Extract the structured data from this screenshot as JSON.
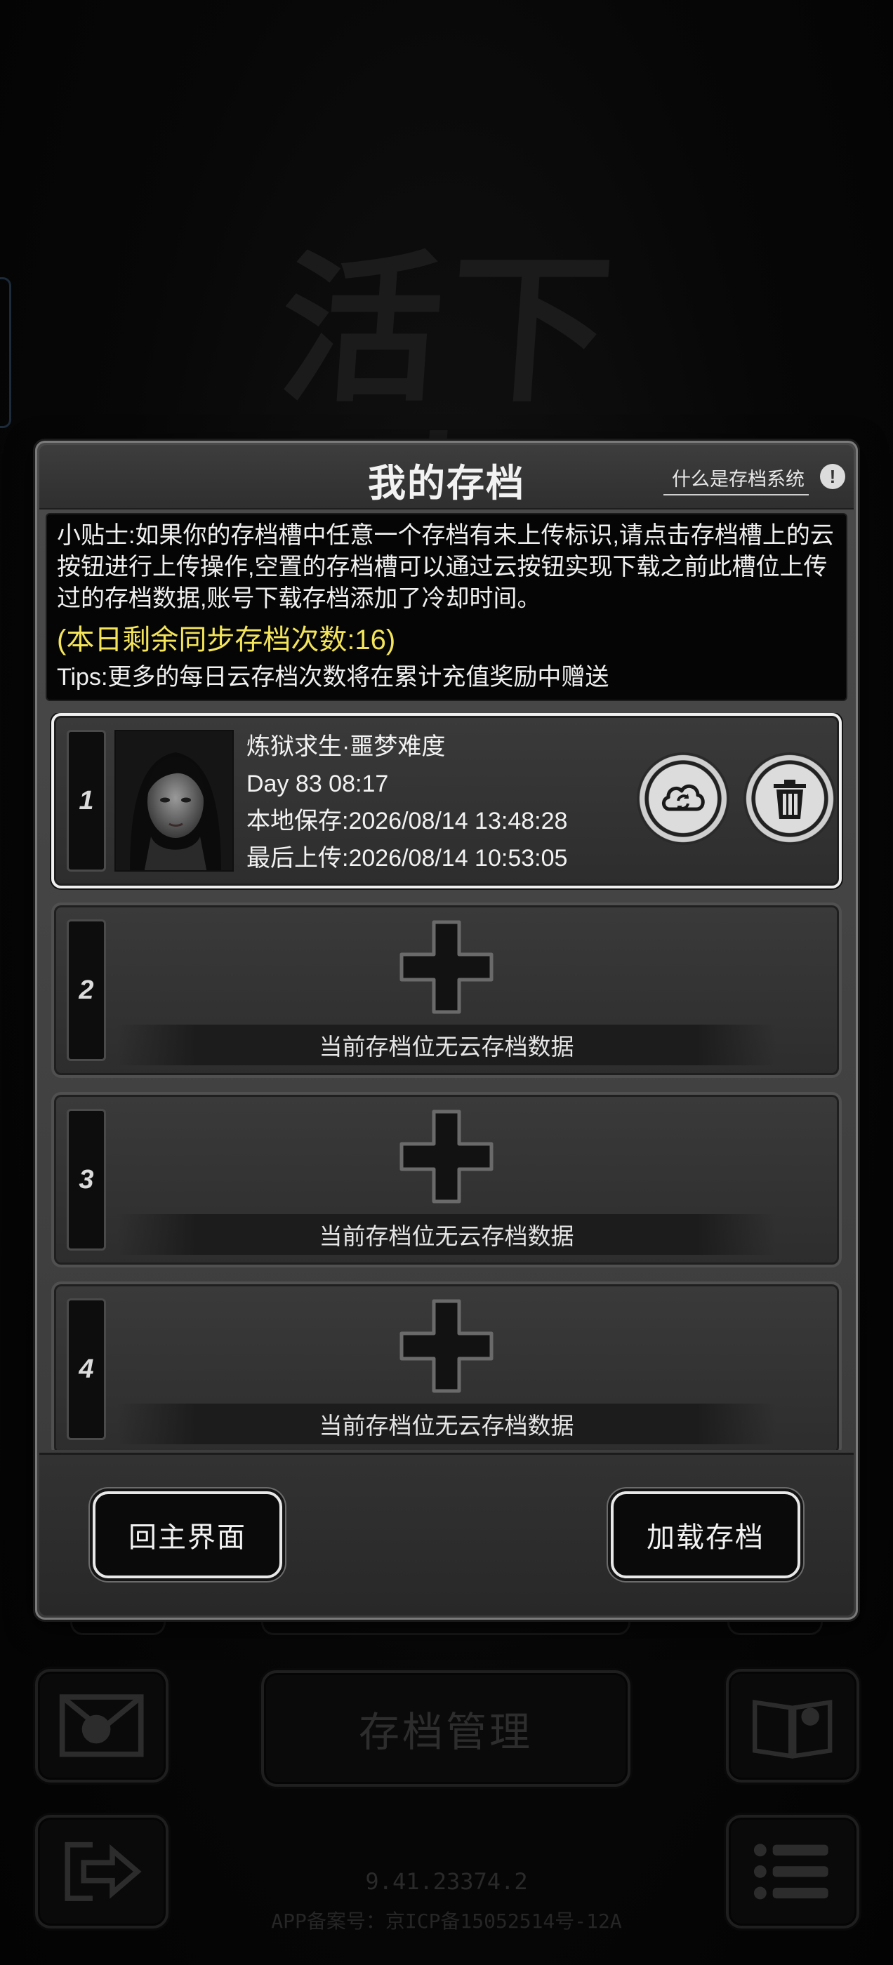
{
  "background": {
    "logo_text": "活下去",
    "manage_button": "存档管理",
    "version": "9.41.23374.2",
    "icp": "APP备案号：京ICP备15052514号-12A"
  },
  "modal": {
    "title": "我的存档",
    "help_link": "什么是存档系统",
    "help_icon": "!",
    "tips": {
      "main": "小贴士:如果你的存档槽中任意一个存档有未上传标识,请点击存档槽上的云按钮进行上传操作,空置的存档槽可以通过云按钮实现下载之前此槽位上传过的存档数据,账号下载存档添加了冷却时间。",
      "sync_count": "(本日剩余同步存档次数:16)",
      "extra": "Tips:更多的每日云存档次数将在累计充值奖励中赠送"
    },
    "slots": [
      {
        "number": "1",
        "title": "炼狱求生·噩梦难度",
        "day": "Day 83  08:17",
        "local_save": "本地保存:2026/08/14  13:48:28",
        "last_upload": "最后上传:2026/08/14  10:53:05",
        "upload_icon": "cloud-sync-icon",
        "delete_icon": "trash-icon"
      },
      {
        "number": "2",
        "empty_text": "当前存档位无云存档数据",
        "add_icon": "plus-icon"
      },
      {
        "number": "3",
        "empty_text": "当前存档位无云存档数据",
        "add_icon": "plus-icon"
      },
      {
        "number": "4",
        "empty_text": "当前存档位无云存档数据",
        "add_icon": "plus-icon"
      }
    ],
    "footer": {
      "back_label": "回主界面",
      "load_label": "加载存档"
    }
  },
  "colors": {
    "sync_count": "#f3e45a",
    "selected_border": "#f0f0f0"
  }
}
